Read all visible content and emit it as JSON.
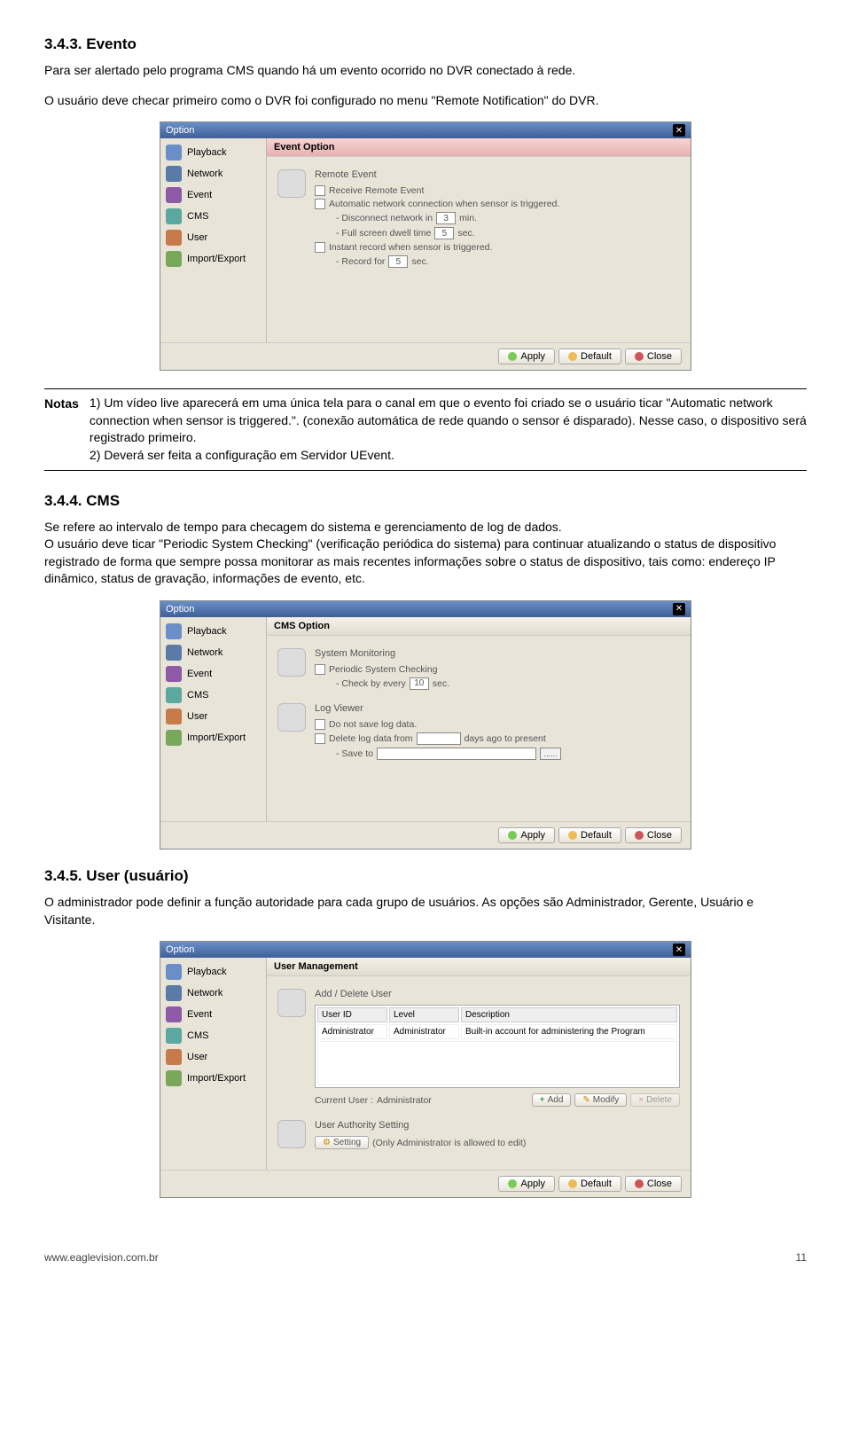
{
  "section1": {
    "heading": "3.4.3. Evento",
    "p1": "Para ser alertado pelo programa CMS quando há um evento ocorrido no DVR conectado à rede.",
    "p2": "O usuário deve checar primeiro como o DVR foi configurado no menu \"Remote Notification\" do DVR."
  },
  "dialog1": {
    "title": "Option",
    "nav": [
      "Playback",
      "Network",
      "Event",
      "CMS",
      "User",
      "Import/Export"
    ],
    "sectionHeader": "Event Option",
    "groupTitle": "Remote Event",
    "chk1": "Receive Remote Event",
    "chk2": "Automatic network connection when sensor is triggered.",
    "l_disconnect": "- Disconnect network in",
    "v_disconnect": "3",
    "u_min": "min.",
    "l_dwell": "- Full screen dwell time",
    "v_dwell": "5",
    "u_sec": "sec.",
    "chk3": "Instant record when sensor is triggered.",
    "l_record": "- Record for",
    "v_record": "5",
    "btn_apply": "Apply",
    "btn_default": "Default",
    "btn_close": "Close"
  },
  "notas": {
    "label": "Notas",
    "text": "1) Um vídeo live aparecerá em uma única tela para o canal em que o evento foi criado  se o usuário ticar \"Automatic network connection when sensor is triggered.\". (conexão automática de rede quando o sensor é disparado). Nesse caso, o dispositivo será registrado primeiro.\n2) Deverá ser feita a configuração em Servidor UEvent."
  },
  "section2": {
    "heading": "3.4.4. CMS",
    "p1": "Se refere ao intervalo de tempo para checagem do sistema e gerenciamento de log de dados.",
    "p2": "O usuário deve ticar \"Periodic System Checking\" (verificação periódica do sistema) para continuar atualizando o status de dispositivo registrado de forma que sempre possa monitorar as mais recentes informações sobre o status de dispositivo, tais como: endereço IP dinâmico, status de gravação, informações de evento, etc."
  },
  "dialog2": {
    "title": "Option",
    "sectionHeader": "CMS Option",
    "group1Title": "System Monitoring",
    "chk_periodic": "Periodic System Checking",
    "l_check": "- Check by every",
    "v_check": "10",
    "u_sec": "sec.",
    "group2Title": "Log Viewer",
    "chk_nosave": "Do not save log data.",
    "chk_delete": "Delete log data from",
    "l_days": "days ago to present",
    "l_saveto": "- Save to",
    "browse": "......",
    "btn_apply": "Apply",
    "btn_default": "Default",
    "btn_close": "Close"
  },
  "section3": {
    "heading": "3.4.5. User (usuário)",
    "p1": "O administrador pode definir a função autoridade para cada grupo de usuários. As opções são Administrador, Gerente, Usuário e Visitante."
  },
  "dialog3": {
    "title": "Option",
    "sectionHeader": "User Management",
    "group1Title": "Add / Delete User",
    "th_userid": "User ID",
    "th_level": "Level",
    "th_desc": "Description",
    "row_userid": "Administrator",
    "row_level": "Administrator",
    "row_desc": "Built-in account for administering the Program",
    "l_currentuser": "Current User :",
    "v_currentuser": "Administrator",
    "btn_add": "Add",
    "btn_modify": "Modify",
    "btn_delete": "Delete",
    "group2Title": "User Authority Setting",
    "btn_setting": "Setting",
    "note": "(Only Administrator is allowed to edit)",
    "btn_apply": "Apply",
    "btn_default": "Default",
    "btn_close": "Close"
  },
  "footer": {
    "url": "www.eaglevision.com.br",
    "page": "11"
  },
  "navColors": [
    "#6a8fc8",
    "#5a7aa8",
    "#8e5aa8",
    "#5aa8a0",
    "#c87a4a",
    "#7aa85a"
  ]
}
